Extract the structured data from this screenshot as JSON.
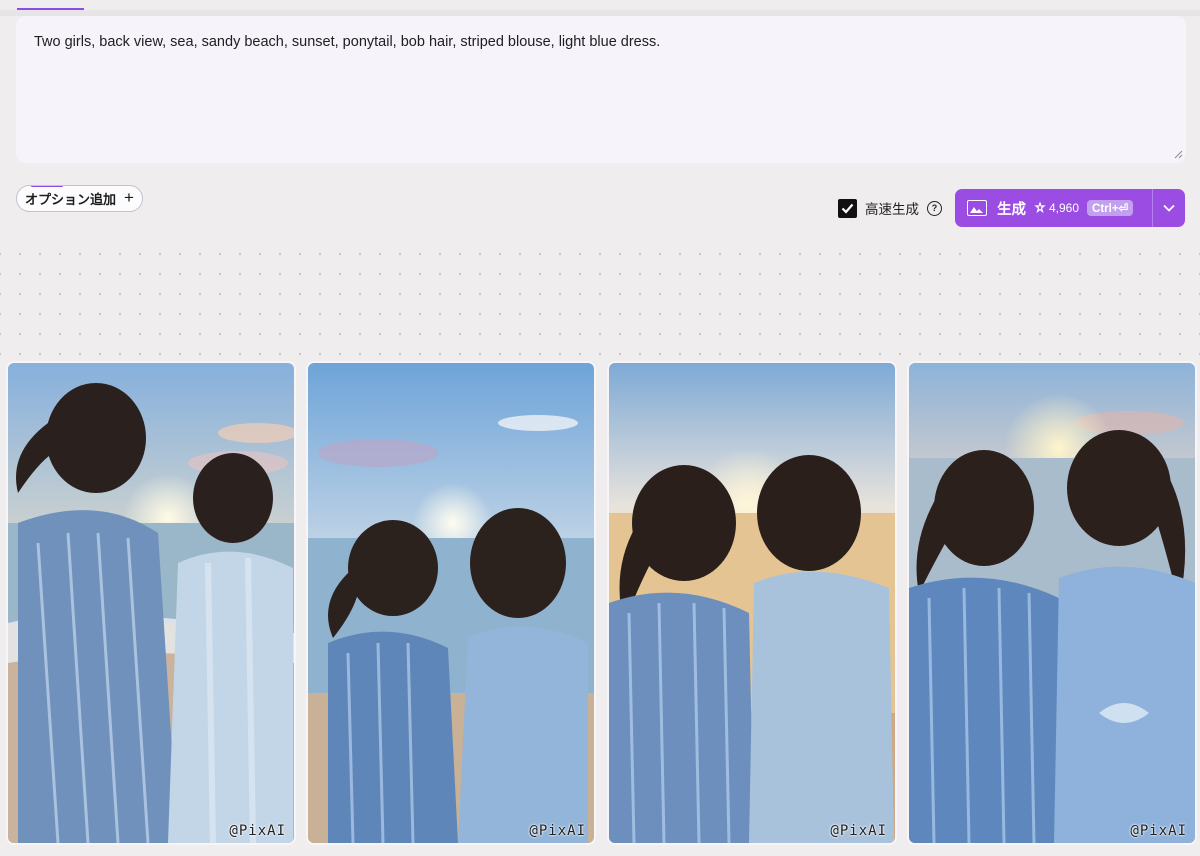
{
  "prompt": {
    "text": "Two girls, back view, sea, sandy beach, sunset, ponytail, bob hair, striped blouse, light blue dress."
  },
  "options": {
    "add_option_label": "オプション追加",
    "add_icon": "plus-icon"
  },
  "fast_generation": {
    "label": "高速生成",
    "checked": true,
    "help_icon": "help-circle-icon"
  },
  "generate_button": {
    "label": "生成",
    "credits": "4,960",
    "shortcut": "Ctrl+⏎",
    "icon": "image-icon",
    "credit_icon": "credit-icon",
    "dropdown_icon": "chevron-down-icon"
  },
  "gallery": {
    "images": [
      {
        "watermark": "@PixAI"
      },
      {
        "watermark": "@PixAI"
      },
      {
        "watermark": "@PixAI"
      },
      {
        "watermark": "@PixAI"
      }
    ]
  },
  "colors": {
    "accent": "#9b4de3",
    "background": "#efeded",
    "prompt_bg": "#f6f3fb"
  }
}
